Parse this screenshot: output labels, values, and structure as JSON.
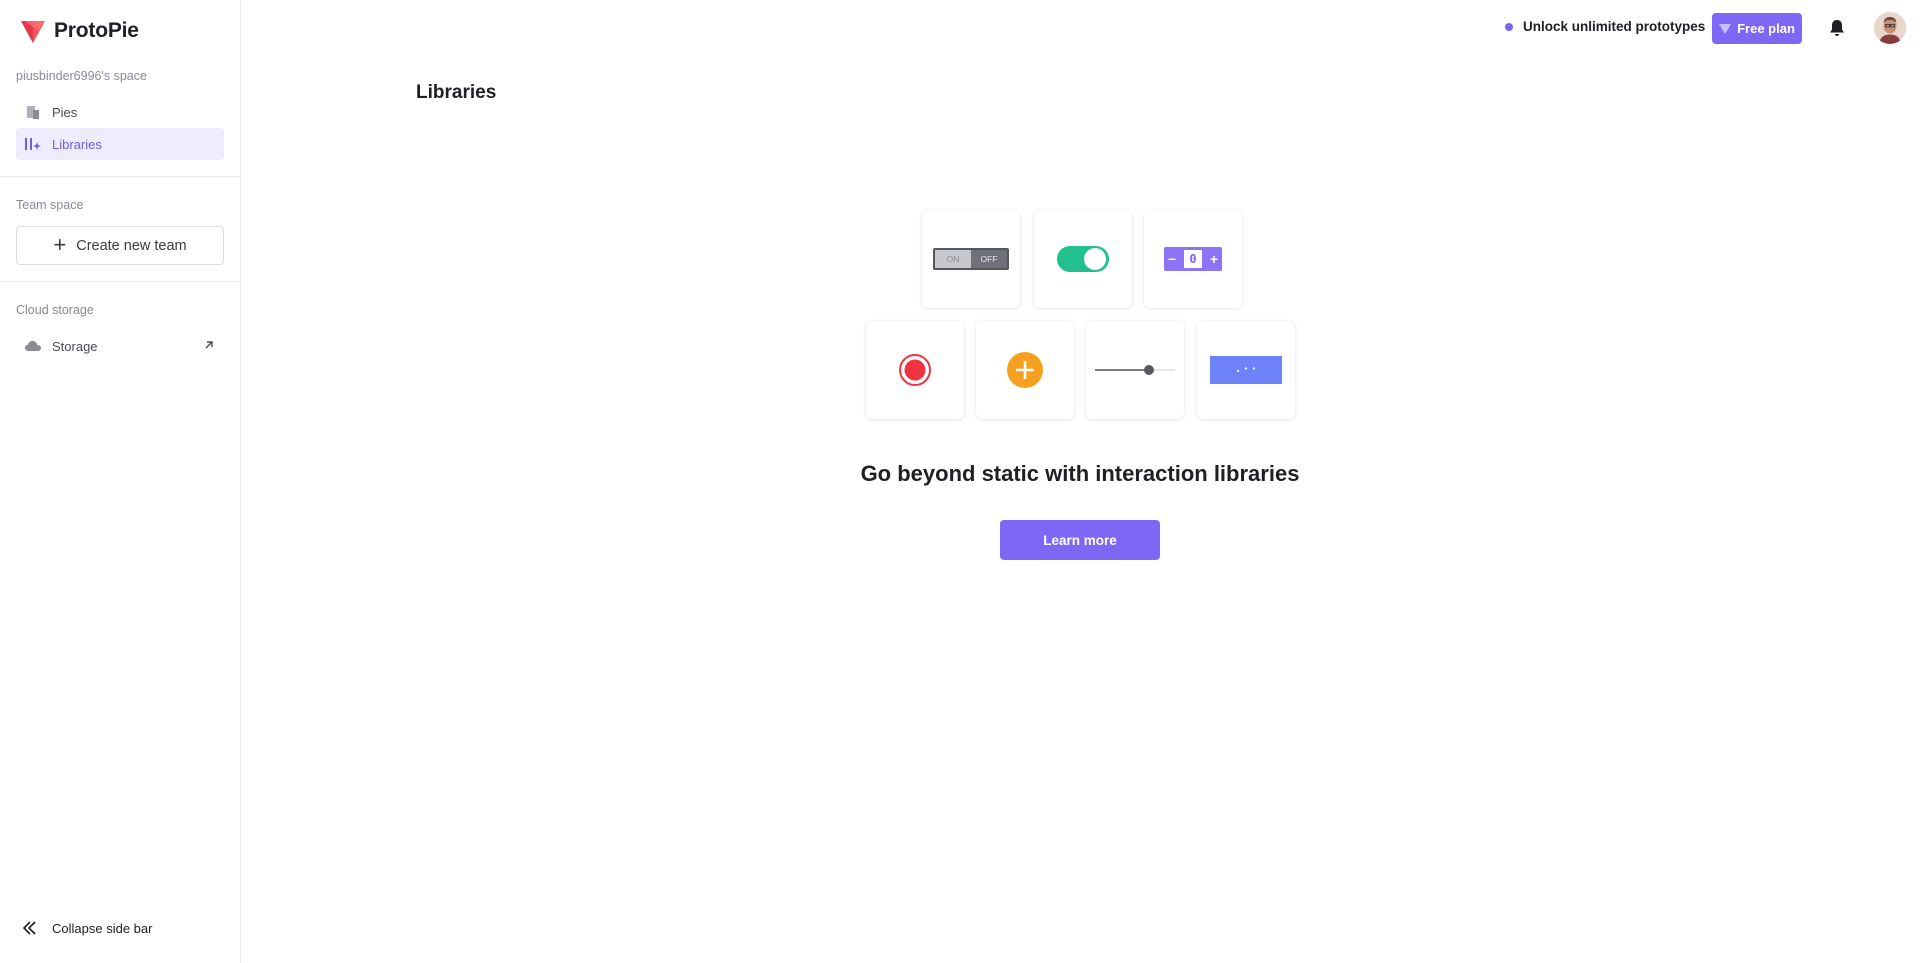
{
  "app": {
    "name": "ProtoPie"
  },
  "sidebar": {
    "space_label": "piusbinder6996's space",
    "items": [
      {
        "label": "Pies",
        "icon": "pies-icon"
      },
      {
        "label": "Libraries",
        "icon": "libraries-icon",
        "active": true
      }
    ],
    "team_section_label": "Team space",
    "create_team_label": "Create new team",
    "cloud_section_label": "Cloud storage",
    "storage_label": "Storage",
    "collapse_label": "Collapse side bar"
  },
  "topbar": {
    "unlock_text": "Unlock unlimited prototypes",
    "plan_label": "Free plan",
    "accent_color": "#7f67f6"
  },
  "main": {
    "title": "Libraries",
    "illustration": {
      "toggle_on_label": "ON",
      "toggle_off_label": "OFF",
      "stepper_minus": "−",
      "stepper_value": "0",
      "stepper_plus": "+",
      "slider_value": 0.7
    },
    "headline": "Go beyond static with interaction libraries",
    "cta_label": "Learn more"
  }
}
